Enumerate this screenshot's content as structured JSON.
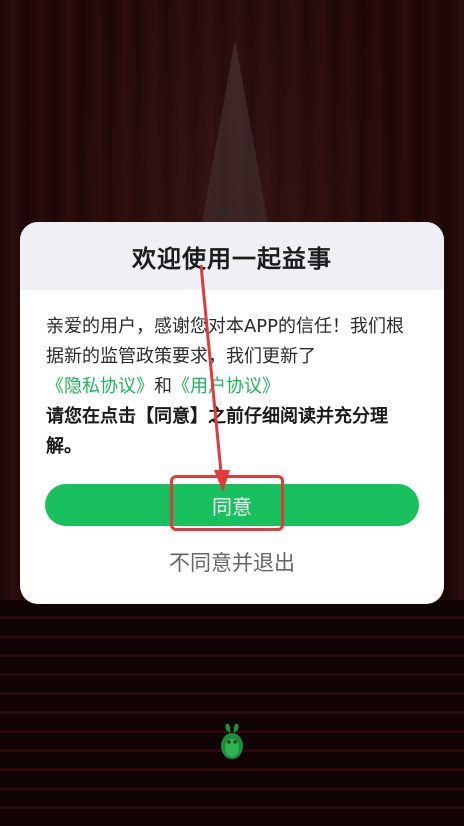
{
  "dialog": {
    "title": "欢迎使用一起益事",
    "body": {
      "intro": "亲爱的用户，感谢您对本APP的信任！我们根据新的监管政策要求，我们更新了",
      "privacy_link": "《隐私协议》",
      "and_text": "和",
      "user_link": "《用户协议》",
      "notice": "请您在点击【同意】之前仔细阅读并充分理解。"
    },
    "agree_label": "同意",
    "disagree_label": "不同意并退出"
  },
  "colors": {
    "accent": "#19c15e",
    "link": "#1fb35a",
    "annotation": "#e03a3a",
    "header_bg": "#eef0f6"
  },
  "icons": {
    "mascot": "green-mascot-icon"
  }
}
